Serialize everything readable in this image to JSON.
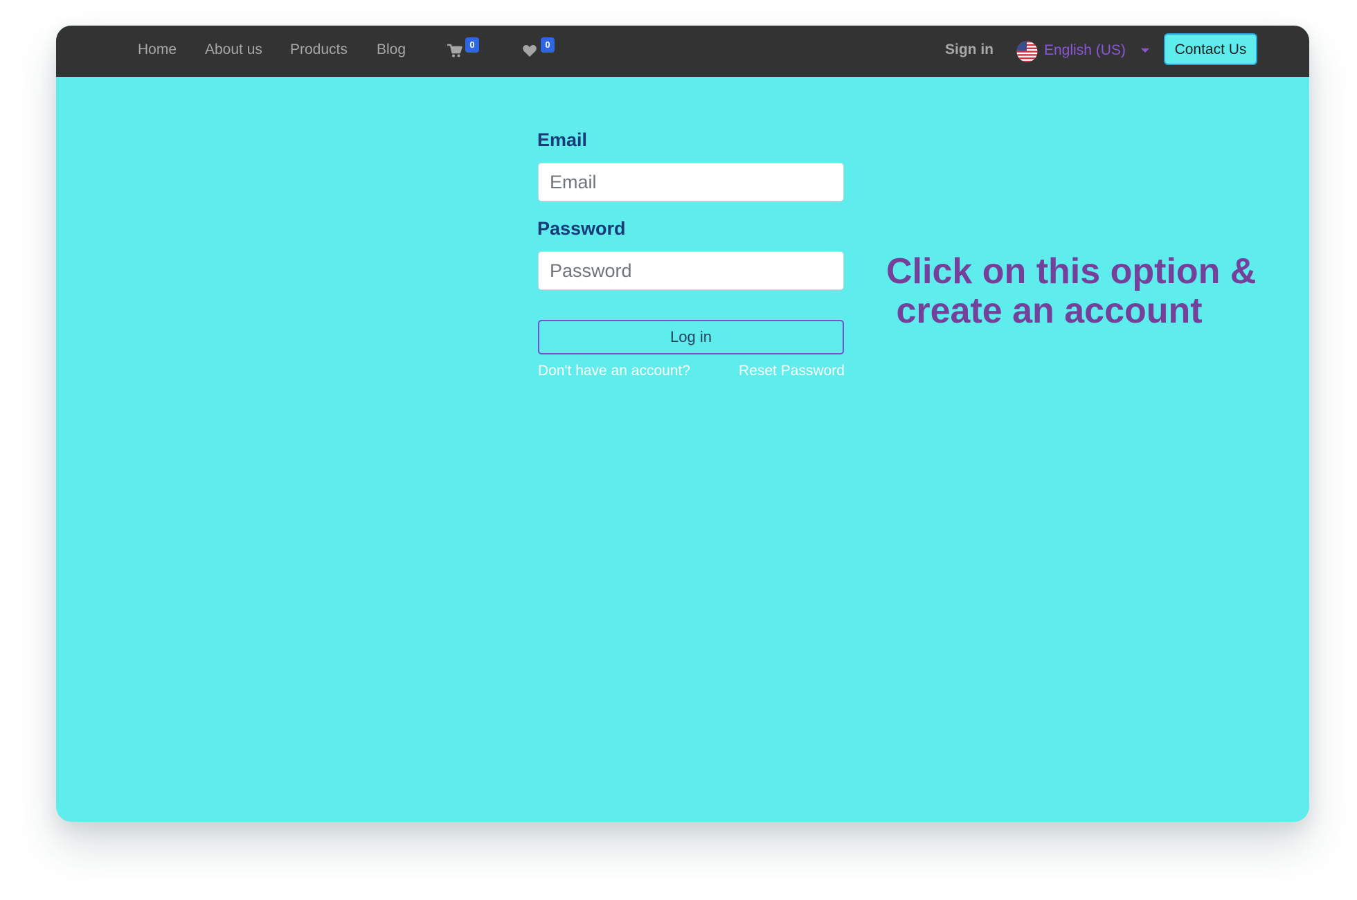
{
  "nav": {
    "links": [
      "Home",
      "About us",
      "Products",
      "Blog"
    ],
    "cart_count": "0",
    "wishlist_count": "0",
    "sign_in": "Sign in",
    "language": "English (US)",
    "contact": "Contact Us"
  },
  "form": {
    "email_label": "Email",
    "email_placeholder": "Email",
    "email_value": "",
    "password_label": "Password",
    "password_placeholder": "Password",
    "password_value": "",
    "login_label": "Log in",
    "signup_link": "Don't have an account?",
    "reset_link": "Reset Password"
  },
  "annotation": {
    "line1": "Click on this option &",
    "line2": " create an account"
  },
  "icons": {
    "cart": "shopping-cart-icon",
    "wishlist": "heart-icon",
    "flag": "us-flag-icon",
    "dropdown": "caret-down-icon"
  },
  "colors": {
    "navbar": "#333333",
    "page_background": "#5eecec",
    "badge": "#2e67e6",
    "label": "#183b78",
    "language": "#8b57d8",
    "annotation": "#75409a",
    "login_border": "#7652d8"
  }
}
